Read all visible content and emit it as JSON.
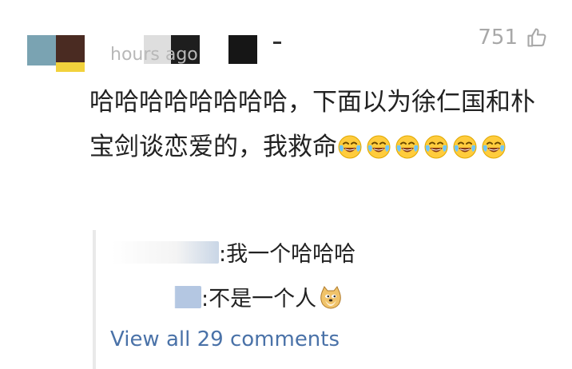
{
  "comment": {
    "timestamp": "hours ago",
    "like_count": "751",
    "text": "哈哈哈哈哈哈哈哈，下面以为徐仁国和朴宝剑谈恋爱的，我救命",
    "emoji_name": "laughing-crying-emoji",
    "emoji_count": 6
  },
  "replies": [
    {
      "text": ":我一个哈哈哈"
    },
    {
      "text": ":不是一个人",
      "emoji_name": "doge-emoji"
    }
  ],
  "view_all_label": "View all 29 comments",
  "colors": {
    "link": "#4a72a8",
    "text": "#222222",
    "meta": "#b8b8b8",
    "reply_border": "#e9e9e9"
  }
}
